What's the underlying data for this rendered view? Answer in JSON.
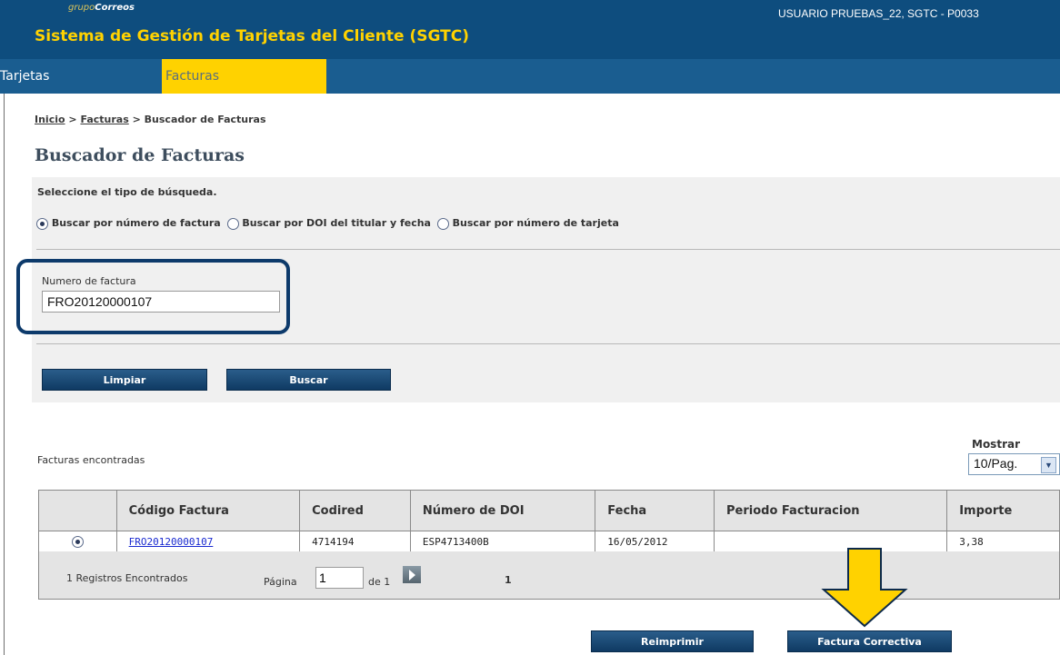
{
  "header": {
    "logo_prefix": "grupo",
    "logo_brand": "Correos",
    "app_title": "Sistema de Gestión de Tarjetas del Cliente (SGTC)",
    "user_info": "USUARIO PRUEBAS_22, SGTC - P0033"
  },
  "nav": {
    "tabs": [
      {
        "label": "Tarjetas"
      },
      {
        "label": "Facturas",
        "active": true
      }
    ]
  },
  "breadcrumb": {
    "home": "Inicio",
    "sep1": ">",
    "section": "Facturas",
    "sep2": ">",
    "current": "Buscador de Facturas"
  },
  "page_title": "Buscador de Facturas",
  "search": {
    "type_label": "Seleccione el tipo de búsqueda.",
    "options": [
      {
        "label": "Buscar por número de factura",
        "selected": true
      },
      {
        "label": "Buscar por DOI del titular y fecha",
        "selected": false
      },
      {
        "label": "Buscar por número de tarjeta",
        "selected": false
      }
    ],
    "field_label": "Numero de factura",
    "field_value": "FRO20120000107",
    "clear_button": "Limpiar",
    "search_button": "Buscar"
  },
  "results": {
    "label": "Facturas encontradas",
    "show_label": "Mostrar",
    "page_size": "10/Pag.",
    "columns": [
      "Código Factura",
      "Codired",
      "Número de DOI",
      "Fecha",
      "Periodo Facturacion",
      "Importe"
    ],
    "rows": [
      {
        "selected": true,
        "codigo": "FRO20120000107",
        "codired": "4714194",
        "doi": "ESP4713400B",
        "fecha": "16/05/2012",
        "periodo": "",
        "importe": "3,38"
      }
    ],
    "count_text": "1 Registros Encontrados",
    "page_label": "Página",
    "page_value": "1",
    "of_label": "de 1",
    "page_link": "1"
  },
  "actions": {
    "reprint_button": "Reimprimir",
    "corrective_button": "Factura Correctiva"
  },
  "colors": {
    "header_bg": "#0e4d7e",
    "accent_yellow": "#ffd200",
    "button_blue": "#0f3a63",
    "highlight_border": "#0d3a6b"
  }
}
